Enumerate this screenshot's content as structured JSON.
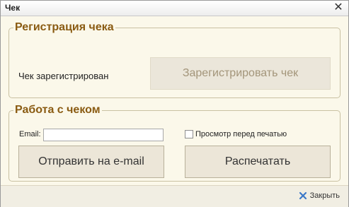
{
  "window": {
    "title": "Чек",
    "close_symbol": "✕"
  },
  "registration": {
    "legend": "Регистрация чека",
    "status_text": "Чек зарегистрирован",
    "register_button": "Зарегистрировать чек"
  },
  "work": {
    "legend": "Работа с чеком",
    "email_label": "Email:",
    "email_value": "",
    "preview_label": "Просмотр перед печатью",
    "preview_checked": false,
    "send_email_button": "Отправить на e-mail",
    "print_button": "Распечатать"
  },
  "footer": {
    "close_label": "Закрыть"
  },
  "colors": {
    "accent_legend": "#8a5b12",
    "close_icon": "#3b78c8"
  }
}
